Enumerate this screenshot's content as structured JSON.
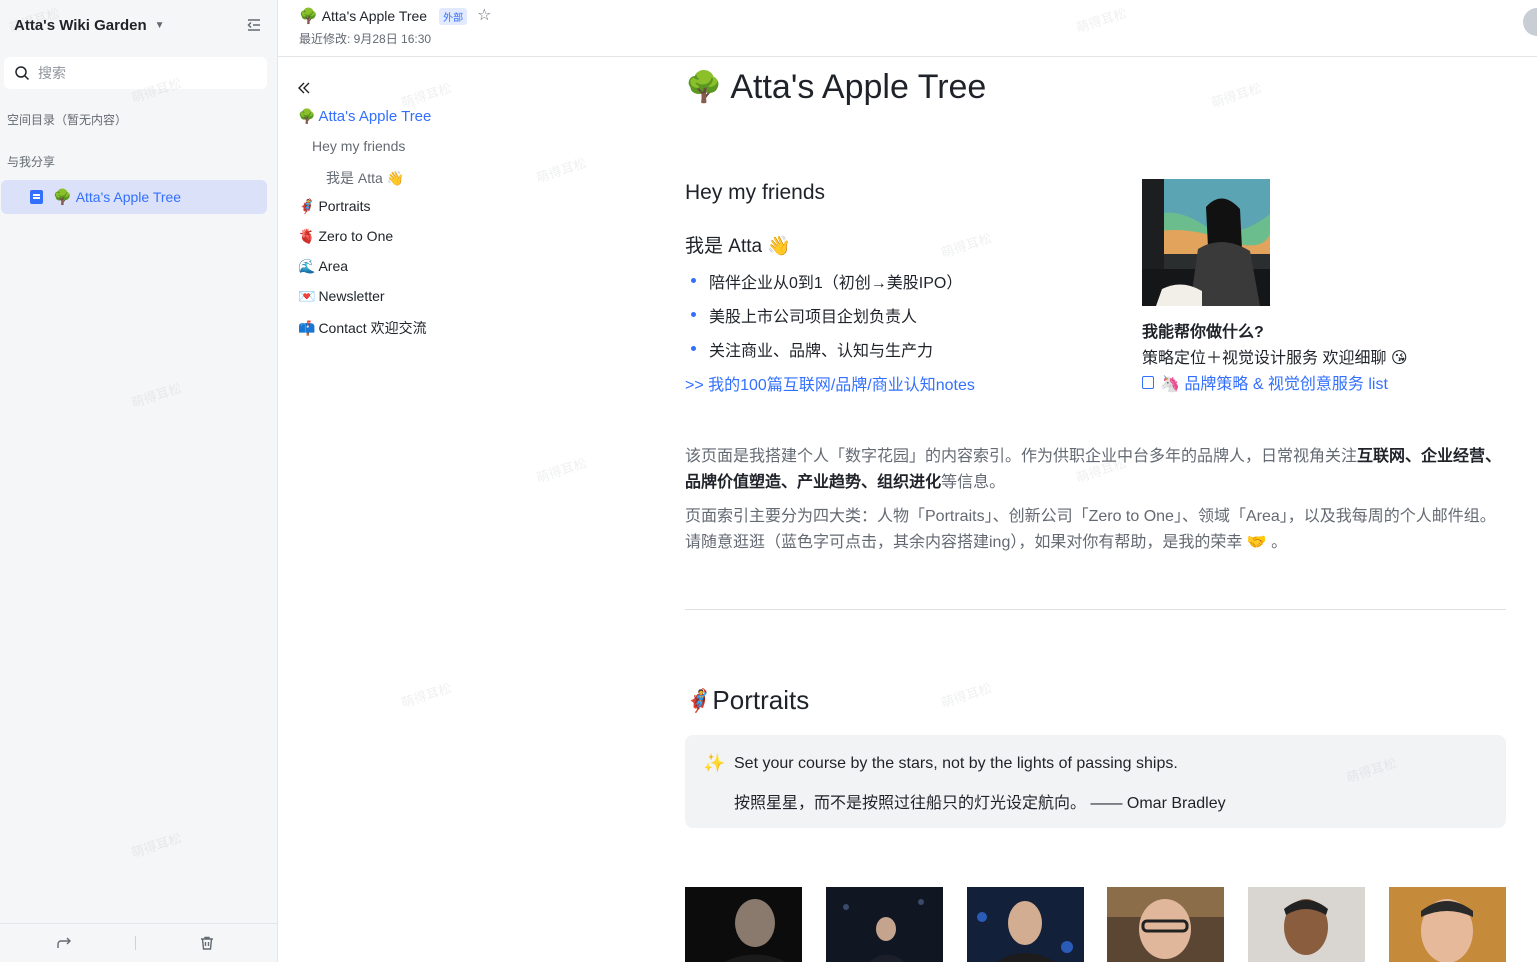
{
  "sidebar": {
    "workspace_title": "Atta's Wiki Garden",
    "search_placeholder": "搜索",
    "section_catalog": "空间目录（暂无内容）",
    "section_shared": "与我分享",
    "items": [
      {
        "emoji": "🌳",
        "label": "Atta's Apple Tree"
      }
    ]
  },
  "topbar": {
    "emoji": "🌳",
    "title": "Atta's Apple Tree",
    "tag": "外部",
    "meta": "最近修改: 9月28日 16:30"
  },
  "outline": {
    "items": [
      {
        "emoji": "🌳",
        "label": "Atta's Apple Tree"
      },
      {
        "emoji": "",
        "label": "Hey my friends"
      },
      {
        "emoji": "",
        "label": "我是 Atta 👋"
      },
      {
        "emoji": "🦸",
        "label": "Portraits"
      },
      {
        "emoji": "🫀",
        "label": "Zero to One"
      },
      {
        "emoji": "🌊",
        "label": "Area"
      },
      {
        "emoji": "💌",
        "label": "Newsletter"
      },
      {
        "emoji": "📫",
        "label": "Contact 欢迎交流"
      }
    ]
  },
  "content": {
    "title_emoji": "🌳",
    "title": "Atta's Apple Tree",
    "h_friends": "Hey my friends",
    "h_iam": "我是 Atta 👋",
    "bullets": [
      "陪伴企业从0到1（初创→美股IPO）",
      "美股上市公司项目企划负责人",
      "关注商业、品牌、认知与生产力"
    ],
    "notes_link": ">> 我的100篇互联网/品牌/商业认知notes",
    "help_title": "我能帮你做什么?",
    "help_text": "策略定位＋视觉设计服务 欢迎细聊 😘",
    "help_link": "🦄 品牌策略 & 视觉创意服务 list",
    "para1_a": "该页面是我搭建个人「数字花园」的内容索引。作为供职企业中台多年的品牌人，日常视角关注",
    "para1_b1": "互联网",
    "para1_sep1": "、",
    "para1_b2": "企业经营",
    "para1_sep2": "、",
    "para1_b3": "品牌价值塑造",
    "para1_sep3": "、",
    "para1_b4": "产业趋势",
    "para1_sep4": "、",
    "para1_b5": "组织进化",
    "para1_c": "等信息。",
    "para2": "页面索引主要分为四大类：人物「Portraits」、创新公司「Zero to One」、领域「Area」，以及我每周的个人邮件组。请随意逛逛（蓝色字可点击，其余内容搭建ing），如果对你有帮助，是我的荣幸 🤝 。",
    "portraits_emoji": "🦸",
    "portraits_title": "Portraits",
    "quote_icon": "✨",
    "quote_en": "Set your course by the stars, not by the lights of passing ships.",
    "quote_zh": "按照星星，而不是按照过往船只的灯光设定航向。 —— Omar Bradley"
  },
  "watermark": "萌得耳松",
  "colors": {
    "accent": "#3370ff",
    "active_bg": "#dbe1f8",
    "sidebar_bg": "#f5f6f7"
  }
}
